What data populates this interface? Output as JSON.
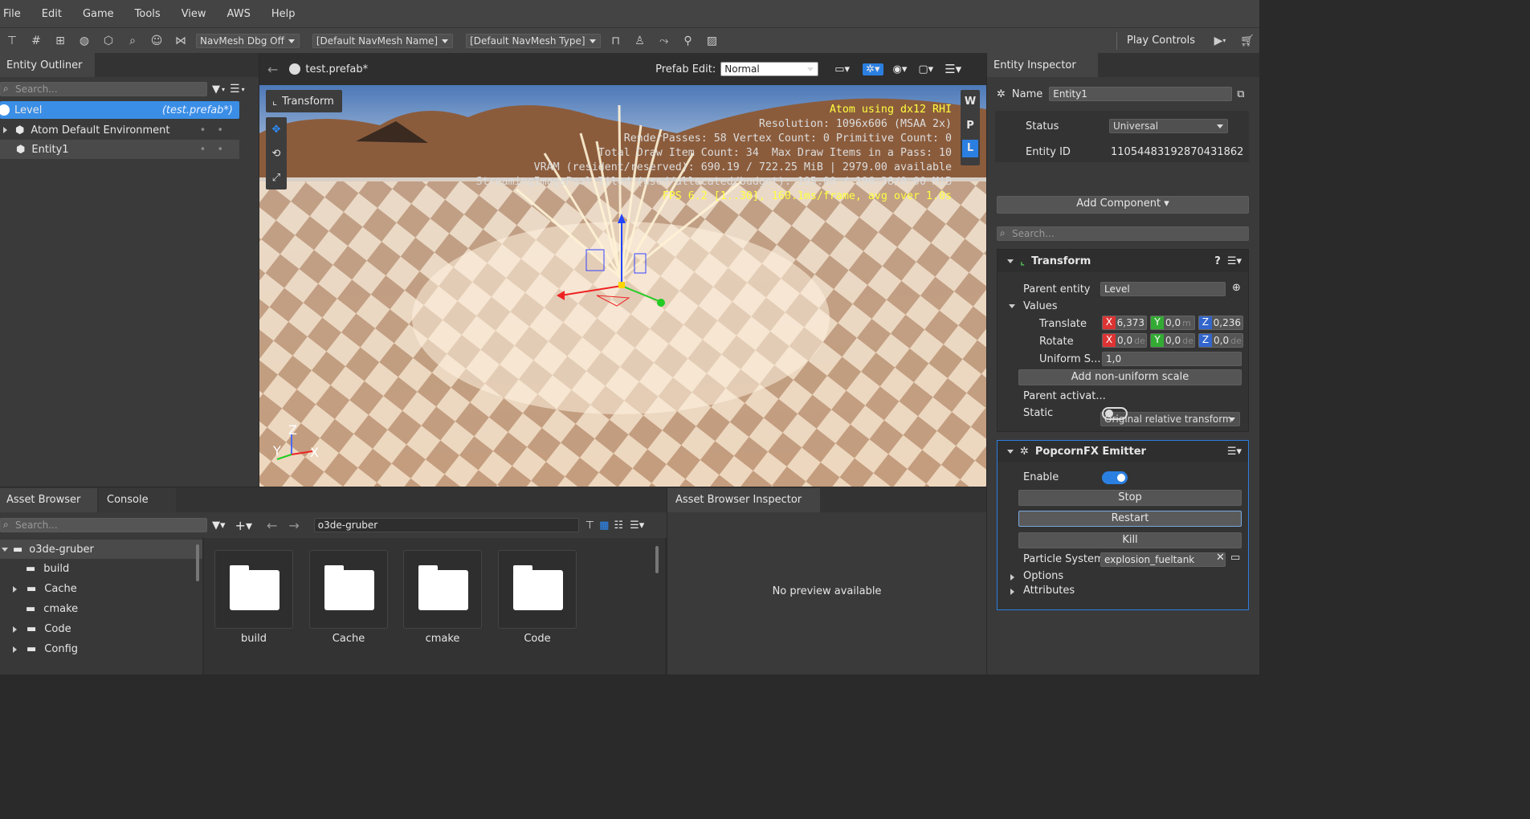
{
  "menu": [
    "File",
    "Edit",
    "Game",
    "Tools",
    "View",
    "AWS",
    "Help"
  ],
  "toolbar": {
    "navmesh_dbg": "NavMesh Dbg Off",
    "navmesh_name": "[Default NavMesh Name]",
    "navmesh_type": "[Default NavMesh Type]",
    "play_controls": "Play Controls"
  },
  "outliner": {
    "title": "Entity Outliner",
    "search_placeholder": "Search...",
    "items": [
      {
        "label": "Level",
        "extra": "(test.prefab*)"
      },
      {
        "label": "Atom Default Environment"
      },
      {
        "label": "Entity1"
      }
    ]
  },
  "viewport": {
    "tab": "test.prefab*",
    "prefab_edit_label": "Prefab Edit:",
    "prefab_edit_value": "Normal",
    "transform_btn": "Transform",
    "side_buttons": [
      "W",
      "P",
      "L"
    ],
    "overlay": [
      "Atom using dx12 RHI",
      "Resolution: 1096x606 (MSAA 2x)",
      "RenderPasses: 58 Vertex Count: 0 Primitive Count: 0",
      "Total Draw Item Count: 34  Max Draw Items in a Pass: 10",
      "VRAM (resident/reserved): 690.19 / 722.25 MiB | 2979.00 available",
      "StreamingImagePool Tiled (used/allocated/budget): 195.00 / 196.38/0.00 MiB",
      "FPS 6.2 [1..30], 160.1ms/frame, avg over 1.0s"
    ],
    "gizmo": {
      "z": "Z",
      "y": "Y",
      "x": "X"
    }
  },
  "inspector": {
    "title": "Entity Inspector",
    "name_label": "Name",
    "name_value": "Entity1",
    "status_label": "Status",
    "status_value": "Universal",
    "id_label": "Entity ID",
    "id_value": "11054483192870431862",
    "add_component": "Add Component ▾",
    "search_placeholder": "Search...",
    "transform": {
      "title": "Transform",
      "help": "?",
      "parent_label": "Parent entity",
      "parent_value": "Level",
      "values_label": "Values",
      "translate_label": "Translate",
      "translate": {
        "x": "6,373",
        "y": "0,0",
        "y_unit": "m",
        "z": "0,236"
      },
      "rotate_label": "Rotate",
      "rotate": {
        "x": "0,0",
        "x_unit": "de",
        "y": "0,0",
        "y_unit": "de",
        "z": "0,0",
        "z_unit": "de"
      },
      "uniform_label": "Uniform S...",
      "uniform_value": "1,0",
      "add_nonuniform": "Add non-uniform scale",
      "parent_act_label": "Parent activat...",
      "parent_act_value": "Original relative transform",
      "static_label": "Static",
      "axis_x": "X",
      "axis_y": "Y",
      "axis_z": "Z"
    },
    "popcorn": {
      "title": "PopcornFX Emitter",
      "enable_label": "Enable",
      "stop": "Stop",
      "restart": "Restart",
      "kill": "Kill",
      "ps_label": "Particle System",
      "ps_value": "explosion_fueltank",
      "options": "Options",
      "attributes": "Attributes"
    }
  },
  "asset_browser": {
    "tab": "Asset Browser",
    "console_tab": "Console",
    "search_placeholder": "Search...",
    "path": "o3de-gruber",
    "tree": [
      {
        "label": "o3de-gruber"
      },
      {
        "label": "build"
      },
      {
        "label": "Cache"
      },
      {
        "label": "cmake"
      },
      {
        "label": "Code"
      },
      {
        "label": "Config"
      }
    ],
    "folders": [
      "build",
      "Cache",
      "cmake",
      "Code"
    ]
  },
  "abi": {
    "title": "Asset Browser Inspector",
    "no_preview": "No preview available"
  },
  "colors": {
    "accent": "#2b7fe0",
    "selected": "#3a8ee6"
  }
}
